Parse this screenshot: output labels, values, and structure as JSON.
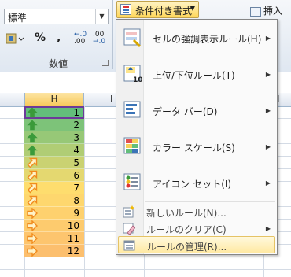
{
  "ribbon": {
    "number_format_value": "標準",
    "number_buttons": [
      "%",
      ","
    ],
    "decimal_increase": "←.0\n.00",
    "decimal_decrease": ".00\n→.0",
    "group_label": "数値",
    "conditional_format_label": "条件付き書式",
    "insert_label": "挿入"
  },
  "columns": {
    "h": "H",
    "i": "I",
    "l": "L"
  },
  "cells": [
    {
      "value": "1",
      "icon": "up"
    },
    {
      "value": "2",
      "icon": "up"
    },
    {
      "value": "3",
      "icon": "up"
    },
    {
      "value": "4",
      "icon": "up"
    },
    {
      "value": "5",
      "icon": "up-right"
    },
    {
      "value": "6",
      "icon": "up-right"
    },
    {
      "value": "7",
      "icon": "up-right"
    },
    {
      "value": "8",
      "icon": "up-right"
    },
    {
      "value": "9",
      "icon": "right"
    },
    {
      "value": "10",
      "icon": "right"
    },
    {
      "value": "11",
      "icon": "right"
    },
    {
      "value": "12",
      "icon": "right"
    }
  ],
  "colors": {
    "up_arrow": "#3a9a3a",
    "side_arrow": "#f08c1e",
    "bar_green": "#63be7b",
    "bar_yellow": "#ffdd6e",
    "bar_orange": "#fcbf6e"
  },
  "menu": {
    "items": [
      {
        "label": "セルの強調表示ルール(H)",
        "icon": "highlight-rules-icon"
      },
      {
        "label": "上位/下位ルール(T)",
        "icon": "top-bottom-rules-icon"
      },
      {
        "label": "データ バー(D)",
        "icon": "data-bars-icon"
      },
      {
        "label": "カラー スケール(S)",
        "icon": "color-scales-icon"
      },
      {
        "label": "アイコン セット(I)",
        "icon": "icon-sets-icon"
      }
    ],
    "small_items": [
      {
        "label": "新しいルール(N)...",
        "icon": "new-rule-icon"
      },
      {
        "label": "ルールのクリア(C)",
        "icon": "clear-rules-icon"
      },
      {
        "label": "ルールの管理(R)...",
        "icon": "manage-rules-icon"
      }
    ],
    "top10_label": "10"
  }
}
